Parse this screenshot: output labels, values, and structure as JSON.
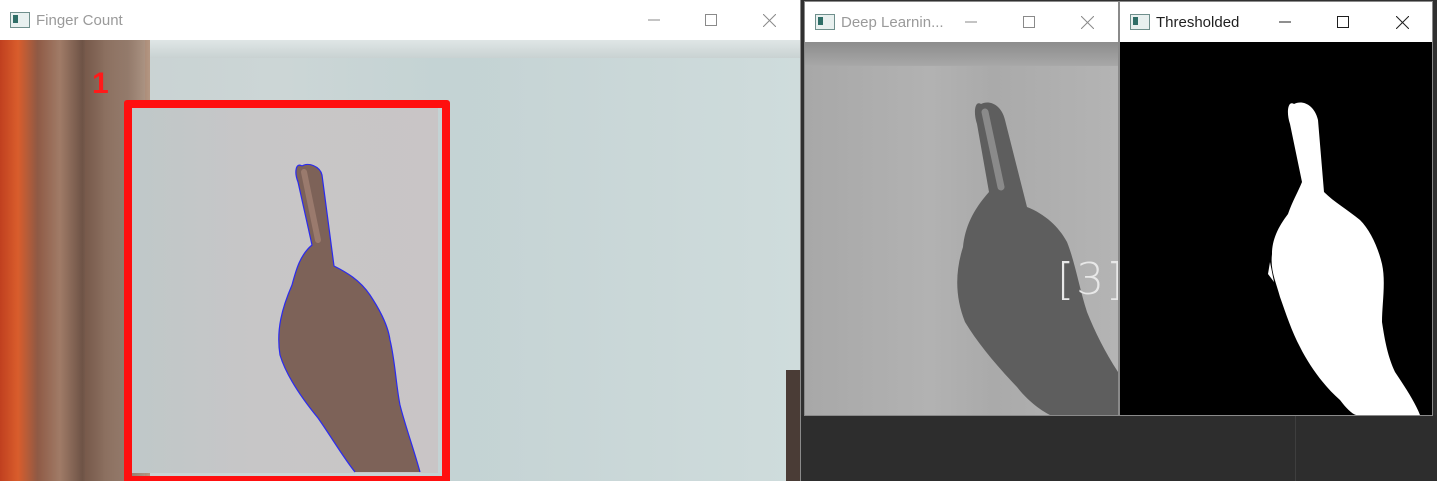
{
  "windows": {
    "finger_count": {
      "title": "Finger Count",
      "count_label": "1"
    },
    "deep_learning": {
      "title": "Deep Learnin...",
      "prediction_label": "[3]"
    },
    "thresholded": {
      "title": "Thresholded"
    }
  },
  "colors": {
    "roi_box": "#ff0f0f",
    "count_text": "#ff1a1a",
    "contour": "#2a2af0"
  },
  "icons": [
    "minimize-icon",
    "maximize-icon",
    "close-icon",
    "app-icon"
  ]
}
